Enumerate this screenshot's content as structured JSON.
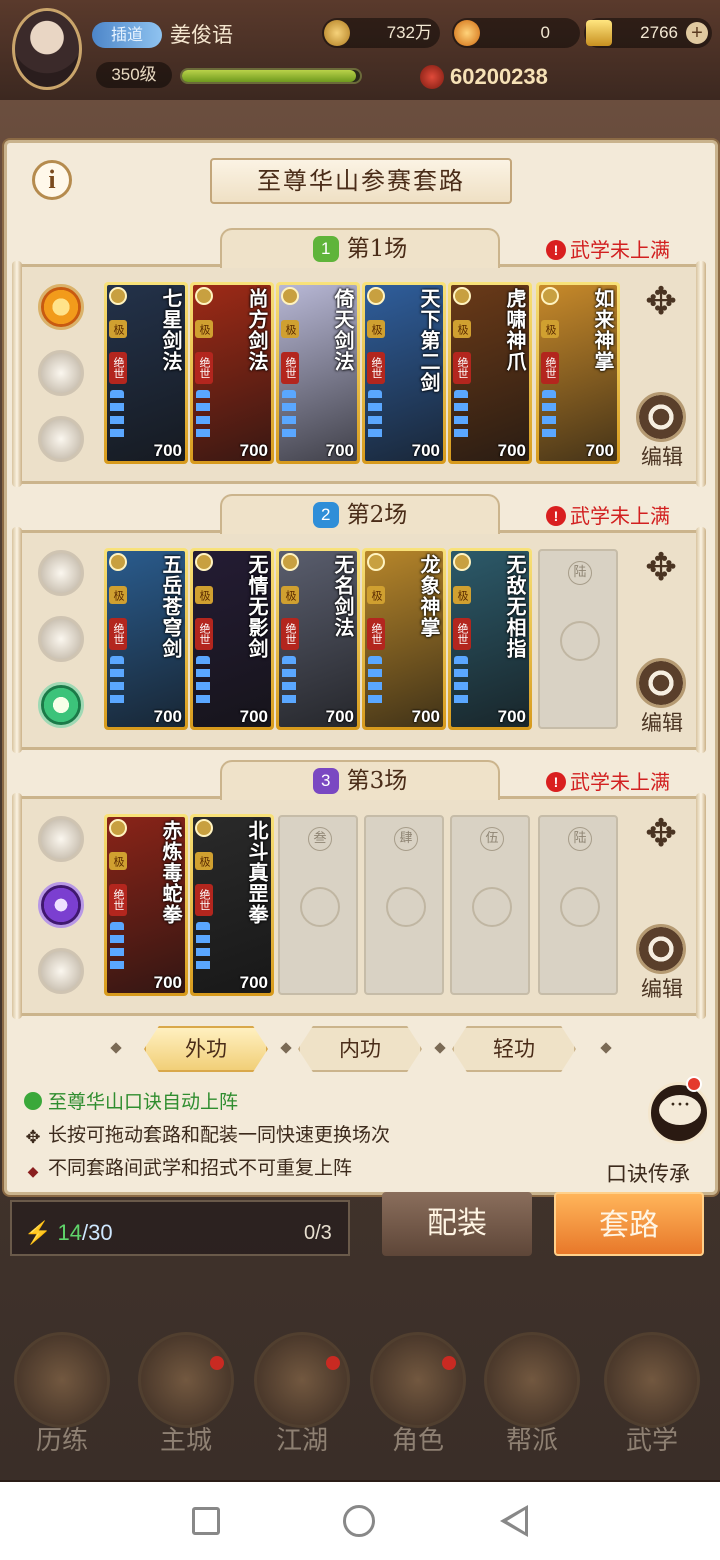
{
  "player": {
    "tag": "插道",
    "name": "姜俊语",
    "level": "350级",
    "xp_fraction": 0.98,
    "coins": "732万",
    "currency2": "0",
    "gold": "2766",
    "power": "60200238"
  },
  "modal": {
    "title": "至尊华山参赛套路",
    "info_icon": "i",
    "rounds": [
      {
        "num": "1",
        "label": "第1场",
        "warning": "武学未上满",
        "orbs": [
          "sun",
          "off",
          "off"
        ],
        "cards": [
          {
            "name": "七星剑法",
            "value": "700",
            "bg": "#23324a"
          },
          {
            "name": "尚方剑法",
            "value": "700",
            "bg": "#9e2a16"
          },
          {
            "name": "倚天剑法",
            "value": "700",
            "bg": "#b8b8d6"
          },
          {
            "name": "天下第二剑",
            "value": "700",
            "bg": "#2f5e9c"
          },
          {
            "name": "虎啸神爪",
            "value": "700",
            "bg": "#6a3a18"
          },
          {
            "name": "如来神掌",
            "value": "700",
            "bg": "#c88a2a"
          }
        ],
        "empty_slots": []
      },
      {
        "num": "2",
        "label": "第2场",
        "warning": "武学未上满",
        "orbs": [
          "off",
          "off",
          "green"
        ],
        "cards": [
          {
            "name": "五岳苍穹剑",
            "value": "700",
            "bg": "#2a5c8e"
          },
          {
            "name": "无情无影剑",
            "value": "700",
            "bg": "#241c34"
          },
          {
            "name": "无名剑法",
            "value": "700",
            "bg": "#5a5e6e"
          },
          {
            "name": "龙象神掌",
            "value": "700",
            "bg": "#b7862a"
          },
          {
            "name": "无敌无相指",
            "value": "700",
            "bg": "#2c5a6a"
          }
        ],
        "empty_slots": [
          "陆"
        ]
      },
      {
        "num": "3",
        "label": "第3场",
        "warning": "武学未上满",
        "orbs": [
          "off",
          "purple",
          "off"
        ],
        "cards": [
          {
            "name": "赤炼毒蛇拳",
            "value": "700",
            "bg": "#8a2418"
          },
          {
            "name": "北斗真罡拳",
            "value": "700",
            "bg": "#2a2a2a"
          }
        ],
        "empty_slots": [
          "叁",
          "肆",
          "伍",
          "陆"
        ]
      }
    ],
    "edit_label": "编辑",
    "filters": [
      "外功",
      "内功",
      "轻功"
    ],
    "active_filter": 0,
    "notes": [
      "至尊华山口诀自动上阵",
      "长按可拖动套路和配装一同快速更换场次",
      "不同套路间武学和招式不可重复上阵"
    ],
    "chat_label": "口诀传承"
  },
  "under": {
    "energy": "14",
    "energy_max": "/30",
    "slot_count": "0/3",
    "tab_peizhuang": "配装",
    "tab_taolu": "套路"
  },
  "nav": [
    "历练",
    "主城",
    "江湖",
    "角色",
    "帮派",
    "武学"
  ],
  "colors": {
    "accent_orange": "#e8782a",
    "warning_red": "#d22020",
    "note_green": "#2f8d2f",
    "card_gold": "#f0c84a"
  }
}
